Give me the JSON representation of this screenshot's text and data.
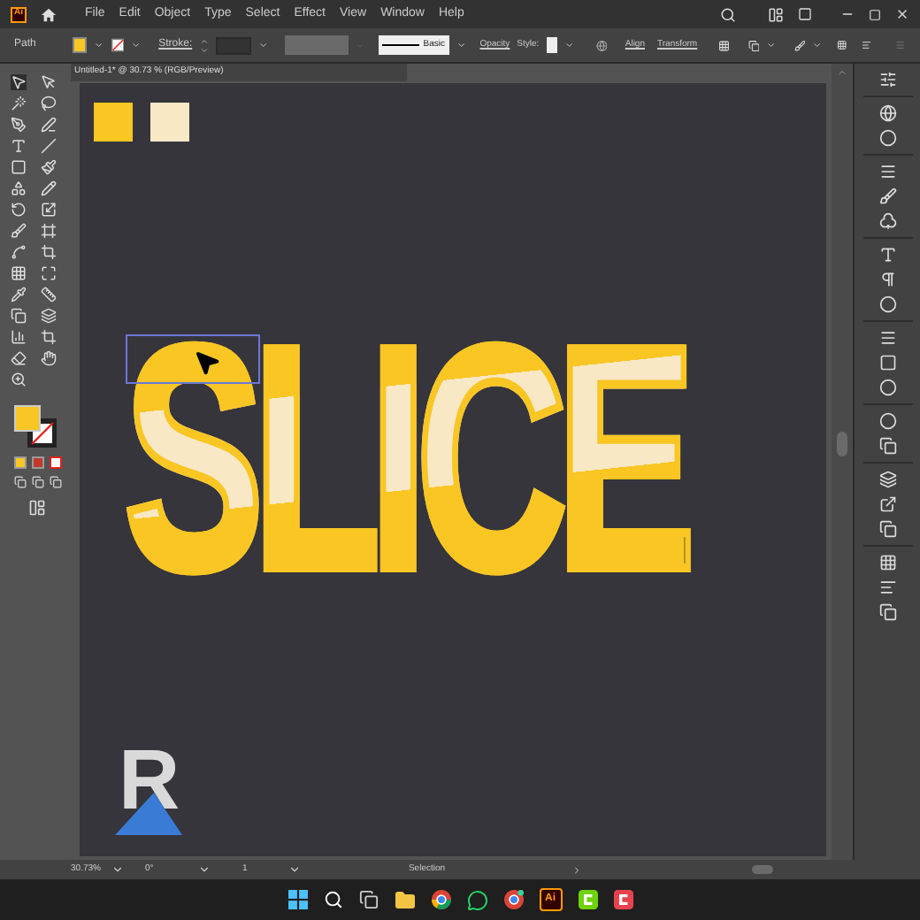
{
  "app": {
    "logo": "Ai"
  },
  "menu": [
    "File",
    "Edit",
    "Object",
    "Type",
    "Select",
    "Effect",
    "View",
    "Window",
    "Help"
  ],
  "control_bar": {
    "selection_label": "Path",
    "stroke_label": "Stroke:",
    "brush": "Basic",
    "opacity_label": "Opacity",
    "style_label": "Style:",
    "align": "Align",
    "transform": "Transform"
  },
  "document_tab": {
    "title": "Untitled-1* @ 30.73 % (RGB/Preview)"
  },
  "canvas": {
    "swatches": [
      {
        "color": "#f9c623"
      },
      {
        "color": "#f8e8c6"
      }
    ],
    "artwork_text": "SLICE",
    "logo_letter": "R"
  },
  "status_bar": {
    "zoom": "30.73%",
    "rotation": "0°",
    "artboard": "1",
    "tool": "Selection"
  },
  "taskbar": {
    "illustrator_label": "Ai"
  }
}
